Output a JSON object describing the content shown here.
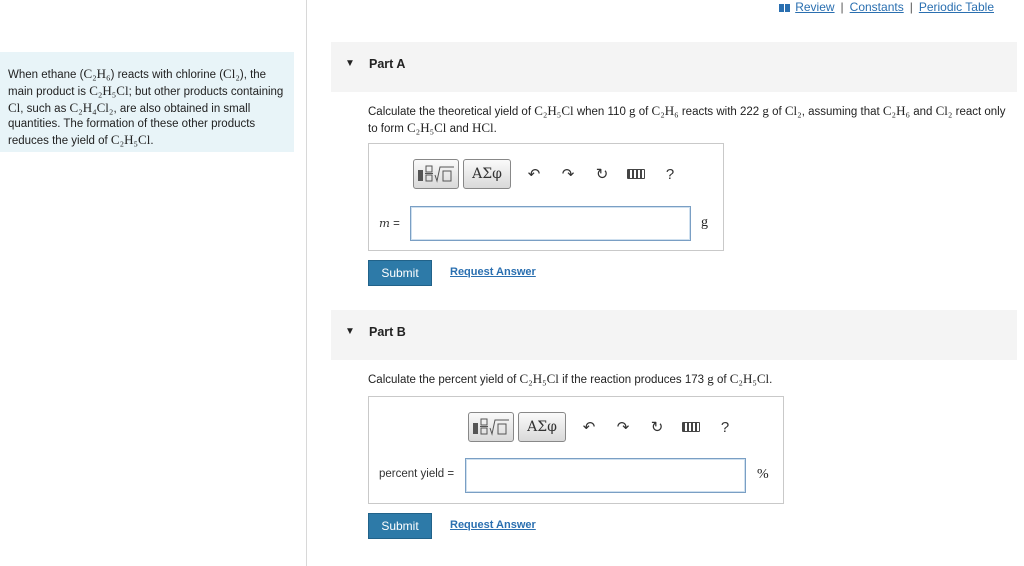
{
  "toplinks": {
    "review": "Review",
    "constants": "Constants",
    "periodic_table": "Periodic Table",
    "sep": "|"
  },
  "intro": {
    "t1": "When ethane (",
    "ethane": "C₂H₆",
    "t2": ") reacts with chlorine (",
    "chlorine": "Cl₂",
    "t3": "), the main product is ",
    "product": "C₂H₅Cl",
    "t4": "; but other products containing ",
    "cl": "Cl",
    "t5": ", such as ",
    "byproduct": "C₂H₄Cl₂",
    "t6": ", are also obtained in small quantities. The formation of these other products reduces the yield of ",
    "product2": "C₂H₅Cl",
    "t7": "."
  },
  "partA": {
    "label": "Part A",
    "q1": "Calculate the theoretical yield of ",
    "q_product": "C₂H₅Cl",
    "q2": " when 110 ",
    "q_g1": "g",
    "q3": " of ",
    "q_ethane": "C₂H₆",
    "q4": " reacts with 222 ",
    "q_g2": "g",
    "q5": " of ",
    "q_cl2": "Cl₂",
    "q6": ", assuming that ",
    "q_ethane2": "C₂H₆",
    "q7": " and ",
    "q_cl2b": "Cl₂",
    "q8": " react only to form ",
    "q_product2": "C₂H₅Cl",
    "q9": " and ",
    "q_hcl": "HCl",
    "q10": ".",
    "greek": "ΑΣφ",
    "help": "?",
    "var_label": "m",
    "equals": " =",
    "input_value": "",
    "unit": "g",
    "submit": "Submit",
    "request": "Request Answer"
  },
  "partB": {
    "label": "Part B",
    "q1": "Calculate the percent yield of ",
    "q_product": "C₂H₅Cl",
    "q2": " if the reaction produces 173 ",
    "q_g": "g",
    "q3": " of ",
    "q_product2": "C₂H₅Cl",
    "q4": ".",
    "greek": "ΑΣφ",
    "help": "?",
    "var_label": "percent yield =",
    "input_value": "",
    "unit": "%",
    "submit": "Submit",
    "request": "Request Answer"
  },
  "colors": {
    "accent": "#2d7aa8",
    "link": "#2a6fb0",
    "intro_bg": "#e8f4f8",
    "header_bg": "#f4f4f4"
  }
}
